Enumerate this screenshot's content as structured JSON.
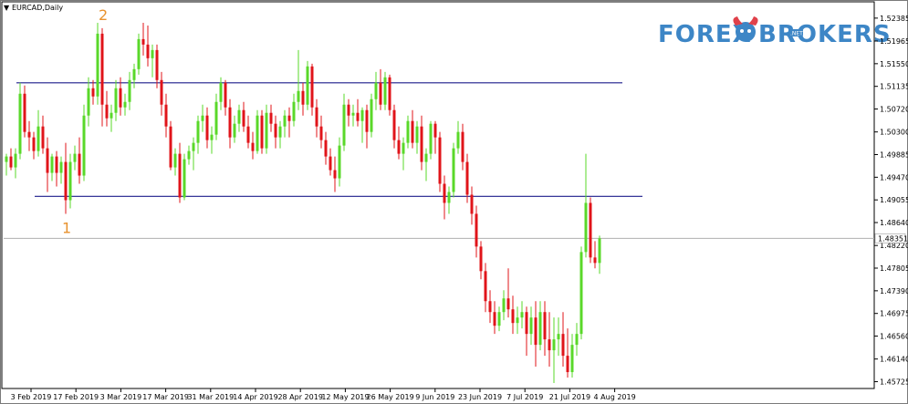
{
  "window": {
    "title": "EURCAD,Daily"
  },
  "logo": {
    "part1": "FOREX",
    "part2": "BROKERS",
    "badge": ".NET"
  },
  "chart_data": {
    "type": "candlestick",
    "symbol": "EURCAD",
    "timeframe": "Daily",
    "ylim": [
      1.456,
      1.5265
    ],
    "y_ticks": [
      "1.52385",
      "1.51965",
      "1.51550",
      "1.51135",
      "1.50720",
      "1.50300",
      "1.49885",
      "1.49470",
      "1.49055",
      "1.48640",
      "1.48220",
      "1.47805",
      "1.47390",
      "1.46975",
      "1.46560",
      "1.46140",
      "1.45725"
    ],
    "x_ticks": [
      "3 Feb 2019",
      "17 Feb 2019",
      "3 Mar 2019",
      "17 Mar 2019",
      "31 Mar 2019",
      "14 Apr 2019",
      "28 Apr 2019",
      "12 May 2019",
      "26 May 2019",
      "9 Jun 2019",
      "23 Jun 2019",
      "7 Jul 2019",
      "21 Jul 2019",
      "4 Aug 2019"
    ],
    "current_price": "1.48351",
    "current_price_value": 1.48351,
    "resistance_level": 1.512,
    "support_level": 1.4912,
    "annotations": [
      {
        "text": "1",
        "date_index": 13,
        "price": 1.4855
      },
      {
        "text": "2",
        "date_index": 21,
        "price": 1.5245
      }
    ],
    "colors": {
      "up": "#5ad82a",
      "down": "#e0141a",
      "level_line": "#1c1c8c",
      "price_line": "#b0b0b0",
      "marker": "#e8922e"
    },
    "candles": [
      {
        "o": 1.4975,
        "h": 1.499,
        "l": 1.495,
        "c": 1.4985
      },
      {
        "o": 1.4985,
        "h": 1.5,
        "l": 1.496,
        "c": 1.4965
      },
      {
        "o": 1.4965,
        "h": 1.5,
        "l": 1.4945,
        "c": 1.499
      },
      {
        "o": 1.499,
        "h": 1.512,
        "l": 1.498,
        "c": 1.51
      },
      {
        "o": 1.51,
        "h": 1.5115,
        "l": 1.502,
        "c": 1.503
      },
      {
        "o": 1.503,
        "h": 1.505,
        "l": 1.4995,
        "c": 1.502
      },
      {
        "o": 1.502,
        "h": 1.503,
        "l": 1.498,
        "c": 1.4995
      },
      {
        "o": 1.4995,
        "h": 1.507,
        "l": 1.4985,
        "c": 1.504
      },
      {
        "o": 1.504,
        "h": 1.506,
        "l": 1.499,
        "c": 1.5
      },
      {
        "o": 1.5,
        "h": 1.502,
        "l": 1.492,
        "c": 1.4955
      },
      {
        "o": 1.4955,
        "h": 1.499,
        "l": 1.494,
        "c": 1.4985
      },
      {
        "o": 1.4985,
        "h": 1.4995,
        "l": 1.493,
        "c": 1.4955
      },
      {
        "o": 1.4955,
        "h": 1.4985,
        "l": 1.4935,
        "c": 1.4975
      },
      {
        "o": 1.4975,
        "h": 1.501,
        "l": 1.488,
        "c": 1.4905
      },
      {
        "o": 1.4905,
        "h": 1.499,
        "l": 1.489,
        "c": 1.4975
      },
      {
        "o": 1.4975,
        "h": 1.5005,
        "l": 1.496,
        "c": 1.499
      },
      {
        "o": 1.499,
        "h": 1.502,
        "l": 1.4935,
        "c": 1.495
      },
      {
        "o": 1.495,
        "h": 1.508,
        "l": 1.494,
        "c": 1.506
      },
      {
        "o": 1.506,
        "h": 1.513,
        "l": 1.504,
        "c": 1.511
      },
      {
        "o": 1.511,
        "h": 1.5125,
        "l": 1.508,
        "c": 1.5095
      },
      {
        "o": 1.5095,
        "h": 1.523,
        "l": 1.508,
        "c": 1.521
      },
      {
        "o": 1.521,
        "h": 1.522,
        "l": 1.504,
        "c": 1.508
      },
      {
        "o": 1.508,
        "h": 1.5105,
        "l": 1.504,
        "c": 1.5055
      },
      {
        "o": 1.5055,
        "h": 1.508,
        "l": 1.503,
        "c": 1.5065
      },
      {
        "o": 1.5065,
        "h": 1.5125,
        "l": 1.505,
        "c": 1.511
      },
      {
        "o": 1.511,
        "h": 1.513,
        "l": 1.506,
        "c": 1.5075
      },
      {
        "o": 1.5075,
        "h": 1.51,
        "l": 1.506,
        "c": 1.5085
      },
      {
        "o": 1.5085,
        "h": 1.514,
        "l": 1.507,
        "c": 1.5125
      },
      {
        "o": 1.5125,
        "h": 1.5155,
        "l": 1.511,
        "c": 1.5145
      },
      {
        "o": 1.5145,
        "h": 1.521,
        "l": 1.5135,
        "c": 1.52
      },
      {
        "o": 1.52,
        "h": 1.523,
        "l": 1.517,
        "c": 1.519
      },
      {
        "o": 1.519,
        "h": 1.5225,
        "l": 1.515,
        "c": 1.5165
      },
      {
        "o": 1.5165,
        "h": 1.519,
        "l": 1.513,
        "c": 1.518
      },
      {
        "o": 1.518,
        "h": 1.519,
        "l": 1.511,
        "c": 1.5125
      },
      {
        "o": 1.5125,
        "h": 1.514,
        "l": 1.506,
        "c": 1.508
      },
      {
        "o": 1.508,
        "h": 1.51,
        "l": 1.502,
        "c": 1.504
      },
      {
        "o": 1.504,
        "h": 1.505,
        "l": 1.496,
        "c": 1.4965
      },
      {
        "o": 1.4965,
        "h": 1.5,
        "l": 1.495,
        "c": 1.499
      },
      {
        "o": 1.499,
        "h": 1.501,
        "l": 1.49,
        "c": 1.491
      },
      {
        "o": 1.491,
        "h": 1.499,
        "l": 1.4905,
        "c": 1.498
      },
      {
        "o": 1.498,
        "h": 1.5005,
        "l": 1.497,
        "c": 1.4995
      },
      {
        "o": 1.4995,
        "h": 1.502,
        "l": 1.496,
        "c": 1.501
      },
      {
        "o": 1.501,
        "h": 1.506,
        "l": 1.499,
        "c": 1.505
      },
      {
        "o": 1.505,
        "h": 1.508,
        "l": 1.503,
        "c": 1.506
      },
      {
        "o": 1.506,
        "h": 1.5075,
        "l": 1.5,
        "c": 1.5015
      },
      {
        "o": 1.5015,
        "h": 1.504,
        "l": 1.499,
        "c": 1.5025
      },
      {
        "o": 1.5025,
        "h": 1.51,
        "l": 1.5015,
        "c": 1.5085
      },
      {
        "o": 1.5085,
        "h": 1.513,
        "l": 1.507,
        "c": 1.512
      },
      {
        "o": 1.512,
        "h": 1.5125,
        "l": 1.506,
        "c": 1.5075
      },
      {
        "o": 1.5075,
        "h": 1.509,
        "l": 1.5,
        "c": 1.502
      },
      {
        "o": 1.502,
        "h": 1.506,
        "l": 1.501,
        "c": 1.5045
      },
      {
        "o": 1.5045,
        "h": 1.508,
        "l": 1.503,
        "c": 1.507
      },
      {
        "o": 1.507,
        "h": 1.5085,
        "l": 1.503,
        "c": 1.504
      },
      {
        "o": 1.504,
        "h": 1.506,
        "l": 1.5,
        "c": 1.501
      },
      {
        "o": 1.501,
        "h": 1.503,
        "l": 1.498,
        "c": 1.4995
      },
      {
        "o": 1.4995,
        "h": 1.507,
        "l": 1.499,
        "c": 1.506
      },
      {
        "o": 1.506,
        "h": 1.507,
        "l": 1.499,
        "c": 1.5
      },
      {
        "o": 1.5,
        "h": 1.508,
        "l": 1.499,
        "c": 1.5065
      },
      {
        "o": 1.5065,
        "h": 1.508,
        "l": 1.503,
        "c": 1.5045
      },
      {
        "o": 1.5045,
        "h": 1.506,
        "l": 1.5,
        "c": 1.502
      },
      {
        "o": 1.502,
        "h": 1.505,
        "l": 1.5,
        "c": 1.504
      },
      {
        "o": 1.504,
        "h": 1.507,
        "l": 1.502,
        "c": 1.506
      },
      {
        "o": 1.506,
        "h": 1.5075,
        "l": 1.502,
        "c": 1.505
      },
      {
        "o": 1.505,
        "h": 1.51,
        "l": 1.504,
        "c": 1.5085
      },
      {
        "o": 1.5085,
        "h": 1.518,
        "l": 1.507,
        "c": 1.5105
      },
      {
        "o": 1.5105,
        "h": 1.512,
        "l": 1.506,
        "c": 1.508
      },
      {
        "o": 1.508,
        "h": 1.516,
        "l": 1.507,
        "c": 1.515
      },
      {
        "o": 1.515,
        "h": 1.5155,
        "l": 1.506,
        "c": 1.5075
      },
      {
        "o": 1.5075,
        "h": 1.509,
        "l": 1.502,
        "c": 1.504
      },
      {
        "o": 1.504,
        "h": 1.506,
        "l": 1.5,
        "c": 1.5015
      },
      {
        "o": 1.5015,
        "h": 1.503,
        "l": 1.497,
        "c": 1.4985
      },
      {
        "o": 1.4985,
        "h": 1.5,
        "l": 1.495,
        "c": 1.496
      },
      {
        "o": 1.496,
        "h": 1.4985,
        "l": 1.492,
        "c": 1.4945
      },
      {
        "o": 1.4945,
        "h": 1.502,
        "l": 1.493,
        "c": 1.5005
      },
      {
        "o": 1.5005,
        "h": 1.51,
        "l": 1.4995,
        "c": 1.508
      },
      {
        "o": 1.508,
        "h": 1.509,
        "l": 1.504,
        "c": 1.506
      },
      {
        "o": 1.506,
        "h": 1.508,
        "l": 1.504,
        "c": 1.5065
      },
      {
        "o": 1.5065,
        "h": 1.509,
        "l": 1.504,
        "c": 1.505
      },
      {
        "o": 1.505,
        "h": 1.5075,
        "l": 1.501,
        "c": 1.507
      },
      {
        "o": 1.507,
        "h": 1.508,
        "l": 1.5,
        "c": 1.503
      },
      {
        "o": 1.503,
        "h": 1.51,
        "l": 1.502,
        "c": 1.509
      },
      {
        "o": 1.509,
        "h": 1.514,
        "l": 1.507,
        "c": 1.512
      },
      {
        "o": 1.512,
        "h": 1.5145,
        "l": 1.507,
        "c": 1.508
      },
      {
        "o": 1.508,
        "h": 1.514,
        "l": 1.507,
        "c": 1.513
      },
      {
        "o": 1.513,
        "h": 1.5135,
        "l": 1.506,
        "c": 1.507
      },
      {
        "o": 1.507,
        "h": 1.508,
        "l": 1.5,
        "c": 1.5015
      },
      {
        "o": 1.5015,
        "h": 1.504,
        "l": 1.498,
        "c": 1.499
      },
      {
        "o": 1.499,
        "h": 1.502,
        "l": 1.496,
        "c": 1.501
      },
      {
        "o": 1.501,
        "h": 1.506,
        "l": 1.5,
        "c": 1.505
      },
      {
        "o": 1.505,
        "h": 1.507,
        "l": 1.5,
        "c": 1.501
      },
      {
        "o": 1.501,
        "h": 1.505,
        "l": 1.499,
        "c": 1.504
      },
      {
        "o": 1.504,
        "h": 1.506,
        "l": 1.496,
        "c": 1.4975
      },
      {
        "o": 1.4975,
        "h": 1.5,
        "l": 1.494,
        "c": 1.499
      },
      {
        "o": 1.499,
        "h": 1.505,
        "l": 1.498,
        "c": 1.5045
      },
      {
        "o": 1.5045,
        "h": 1.505,
        "l": 1.499,
        "c": 1.502
      },
      {
        "o": 1.502,
        "h": 1.503,
        "l": 1.492,
        "c": 1.4935
      },
      {
        "o": 1.4935,
        "h": 1.495,
        "l": 1.487,
        "c": 1.49
      },
      {
        "o": 1.49,
        "h": 1.493,
        "l": 1.488,
        "c": 1.492
      },
      {
        "o": 1.492,
        "h": 1.501,
        "l": 1.491,
        "c": 1.5
      },
      {
        "o": 1.5,
        "h": 1.505,
        "l": 1.499,
        "c": 1.503
      },
      {
        "o": 1.503,
        "h": 1.5045,
        "l": 1.496,
        "c": 1.4975
      },
      {
        "o": 1.4975,
        "h": 1.499,
        "l": 1.49,
        "c": 1.4915
      },
      {
        "o": 1.4915,
        "h": 1.493,
        "l": 1.486,
        "c": 1.488
      },
      {
        "o": 1.488,
        "h": 1.4895,
        "l": 1.48,
        "c": 1.482
      },
      {
        "o": 1.482,
        "h": 1.483,
        "l": 1.476,
        "c": 1.4775
      },
      {
        "o": 1.4775,
        "h": 1.479,
        "l": 1.47,
        "c": 1.472
      },
      {
        "o": 1.472,
        "h": 1.474,
        "l": 1.468,
        "c": 1.47
      },
      {
        "o": 1.47,
        "h": 1.472,
        "l": 1.466,
        "c": 1.4675
      },
      {
        "o": 1.4675,
        "h": 1.471,
        "l": 1.4665,
        "c": 1.47
      },
      {
        "o": 1.47,
        "h": 1.474,
        "l": 1.4685,
        "c": 1.4725
      },
      {
        "o": 1.4725,
        "h": 1.478,
        "l": 1.469,
        "c": 1.4705
      },
      {
        "o": 1.4705,
        "h": 1.473,
        "l": 1.466,
        "c": 1.468
      },
      {
        "o": 1.468,
        "h": 1.471,
        "l": 1.466,
        "c": 1.469
      },
      {
        "o": 1.469,
        "h": 1.472,
        "l": 1.467,
        "c": 1.47
      },
      {
        "o": 1.47,
        "h": 1.471,
        "l": 1.462,
        "c": 1.466
      },
      {
        "o": 1.466,
        "h": 1.471,
        "l": 1.464,
        "c": 1.469
      },
      {
        "o": 1.469,
        "h": 1.472,
        "l": 1.46,
        "c": 1.464
      },
      {
        "o": 1.464,
        "h": 1.472,
        "l": 1.463,
        "c": 1.47
      },
      {
        "o": 1.47,
        "h": 1.472,
        "l": 1.462,
        "c": 1.465
      },
      {
        "o": 1.465,
        "h": 1.47,
        "l": 1.46,
        "c": 1.463
      },
      {
        "o": 1.463,
        "h": 1.469,
        "l": 1.457,
        "c": 1.465
      },
      {
        "o": 1.465,
        "h": 1.469,
        "l": 1.462,
        "c": 1.466
      },
      {
        "o": 1.466,
        "h": 1.47,
        "l": 1.46,
        "c": 1.462
      },
      {
        "o": 1.462,
        "h": 1.467,
        "l": 1.458,
        "c": 1.459
      },
      {
        "o": 1.459,
        "h": 1.466,
        "l": 1.458,
        "c": 1.464
      },
      {
        "o": 1.464,
        "h": 1.468,
        "l": 1.462,
        "c": 1.466
      },
      {
        "o": 1.466,
        "h": 1.482,
        "l": 1.465,
        "c": 1.481
      },
      {
        "o": 1.481,
        "h": 1.499,
        "l": 1.48,
        "c": 1.49
      },
      {
        "o": 1.49,
        "h": 1.491,
        "l": 1.479,
        "c": 1.48
      },
      {
        "o": 1.48,
        "h": 1.483,
        "l": 1.478,
        "c": 1.479
      },
      {
        "o": 1.479,
        "h": 1.484,
        "l": 1.477,
        "c": 1.4835
      }
    ]
  }
}
